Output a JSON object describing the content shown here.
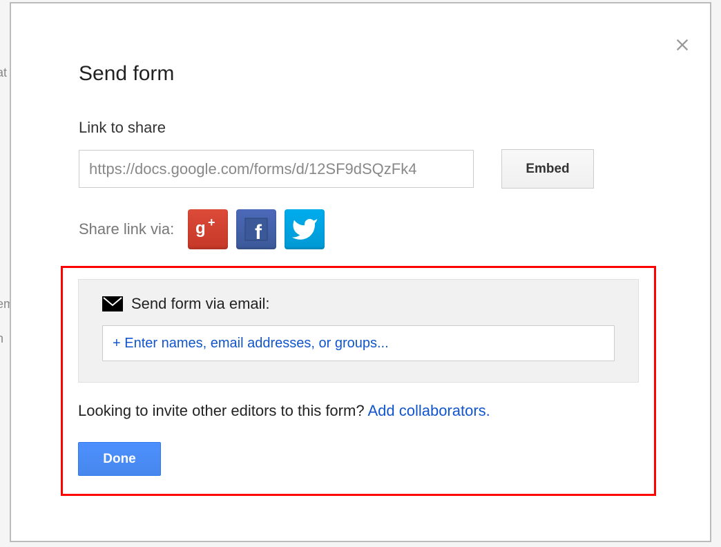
{
  "background": {
    "text1": "at",
    "text2": "em",
    "text3": "n"
  },
  "dialog": {
    "title": "Send form",
    "link_label": "Link to share",
    "link_value": "https://docs.google.com/forms/d/12SF9dSQzFk4",
    "embed_label": "Embed",
    "share_via_label": "Share link via:",
    "email_section": {
      "label": "Send form via email:",
      "placeholder": "+ Enter names, email addresses, or groups..."
    },
    "invite_text": "Looking to invite other editors to this form? ",
    "add_collaborators": "Add collaborators.",
    "done_label": "Done"
  }
}
